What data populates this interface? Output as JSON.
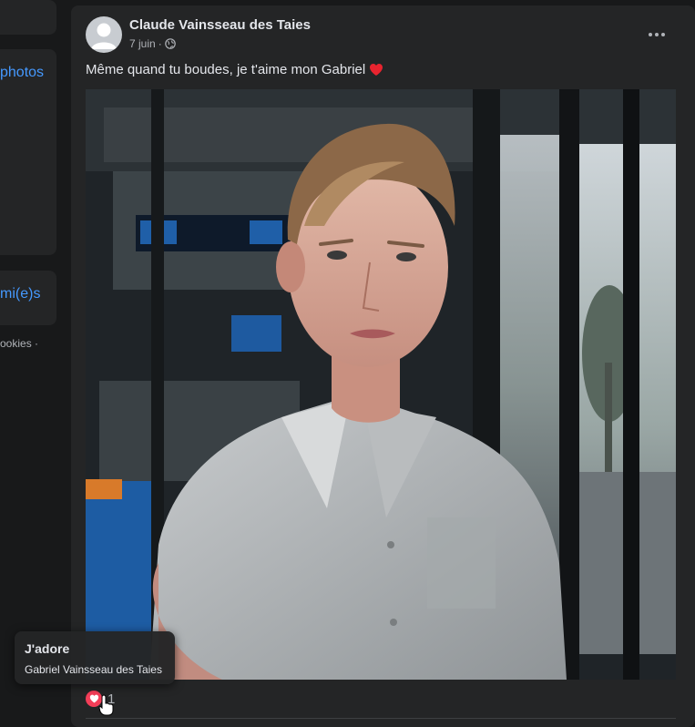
{
  "left_column": {
    "photos_link": "photos",
    "friends_link": "mi(e)s",
    "footer_text": "ookies ·"
  },
  "post": {
    "author": "Claude Vainsseau des Taies",
    "date": "7 juin",
    "date_separator": "·",
    "privacy_icon": "globe-icon",
    "more_icon": "more-horizontal-icon",
    "caption": "Même quand tu boudes, je t'aime mon Gabriel",
    "caption_emoji": "❤️",
    "reactions": {
      "icon": "love-reaction-icon",
      "count": "1"
    }
  },
  "tooltip": {
    "title": "J'adore",
    "name": "Gabriel Vainsseau des Taies"
  },
  "colors": {
    "background": "#18191a",
    "card": "#242526",
    "link": "#4599ff",
    "love": "#f33e58"
  }
}
